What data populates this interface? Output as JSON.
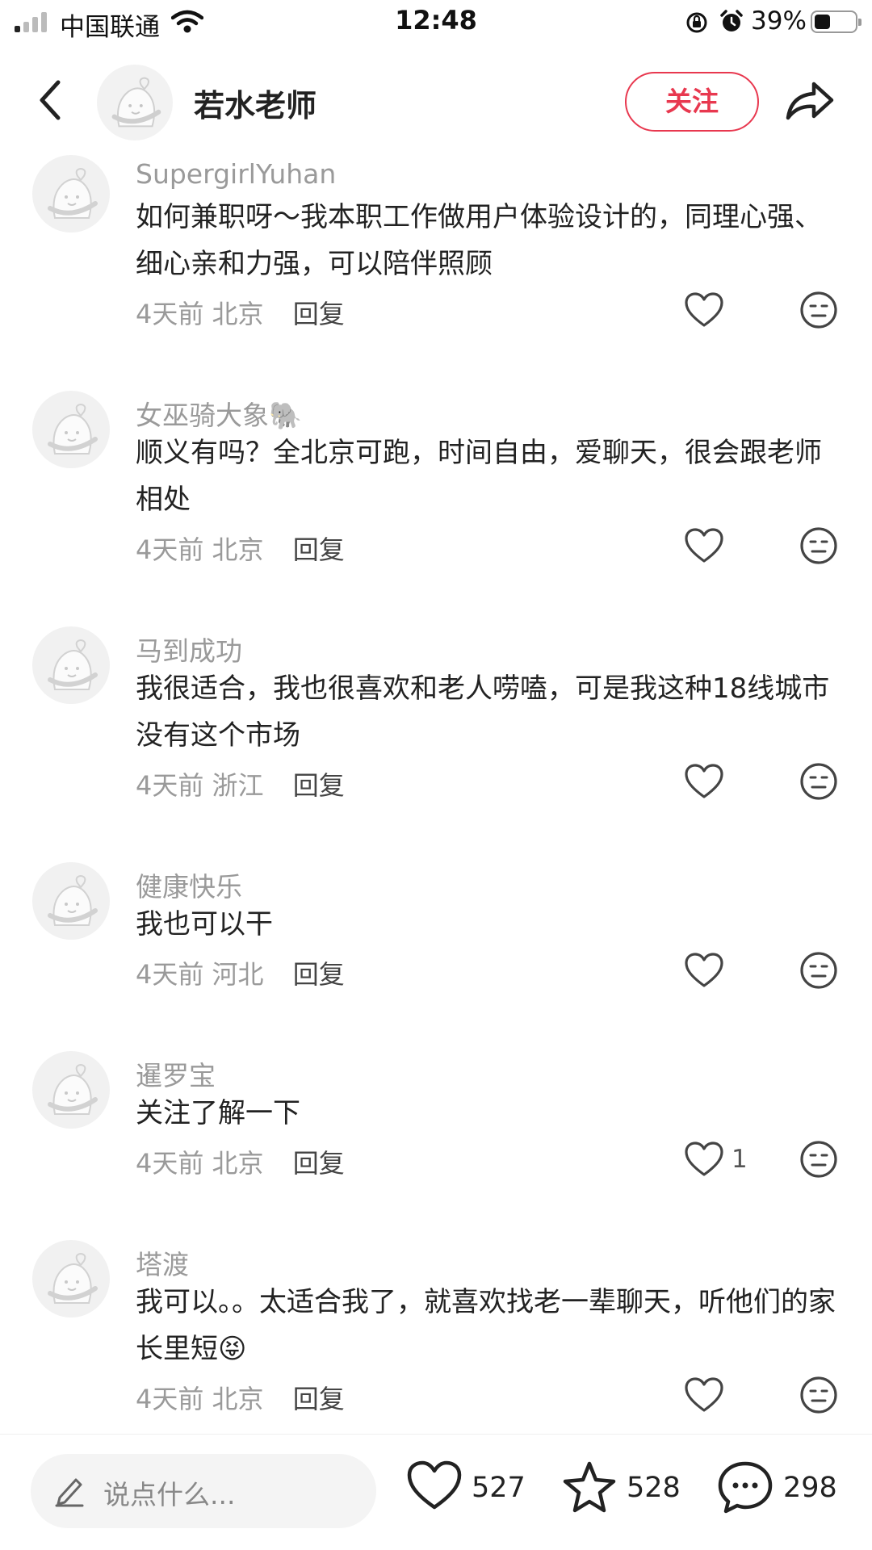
{
  "status": {
    "carrier": "中国联通",
    "time": "12:48",
    "battery_pct": "39%",
    "battery_level": 0.39
  },
  "header": {
    "name": "若水老师",
    "follow_label": "关注"
  },
  "comments": [
    {
      "user": "SupergirlYuhan",
      "text": "如何兼职呀～我本职工作做用户体验设计的，同理心强、细心亲和力强，可以陪伴照顾",
      "time": "4天前",
      "location": "北京",
      "reply": "回复",
      "likes": ""
    },
    {
      "user": "女巫骑大象🐘",
      "text": "顺义有吗？全北京可跑，时间自由，爱聊天，很会跟老师相处",
      "time": "4天前",
      "location": "北京",
      "reply": "回复",
      "likes": ""
    },
    {
      "user": "马到成功",
      "text": "我很适合，我也很喜欢和老人唠嗑，可是我这种18线城市没有这个市场",
      "time": "4天前",
      "location": "浙江",
      "reply": "回复",
      "likes": ""
    },
    {
      "user": "健康快乐",
      "text": "我也可以干",
      "time": "4天前",
      "location": "河北",
      "reply": "回复",
      "likes": ""
    },
    {
      "user": "暹罗宝",
      "text": "关注了解一下",
      "time": "4天前",
      "location": "北京",
      "reply": "回复",
      "likes": "1"
    },
    {
      "user": "塔渡",
      "text": "我可以。。太适合我了，就喜欢找老一辈聊天，听他们的家长里短😝",
      "time": "4天前",
      "location": "北京",
      "reply": "回复",
      "likes": ""
    }
  ],
  "bottom": {
    "input_placeholder": "说点什么...",
    "likes": "527",
    "favorites": "528",
    "comments": "298"
  },
  "colors": {
    "accent": "#e8384f",
    "muted_text": "#9a9a9a"
  }
}
